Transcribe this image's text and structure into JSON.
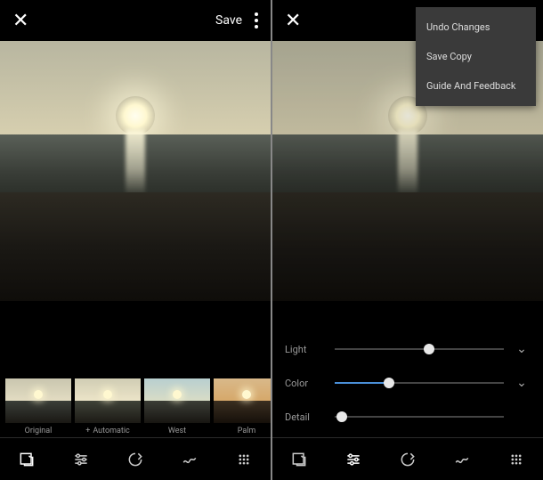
{
  "left": {
    "save_label": "Save",
    "filters": [
      {
        "label": "Original",
        "sky": "linear-gradient(180deg,#c9c6af,#e3dcc2)",
        "bot": "linear-gradient(180deg,#3a3e38,#1a1814)"
      },
      {
        "label": "Automatic",
        "icon": "+",
        "sky": "linear-gradient(180deg,#d0cdb4,#ece4c8)",
        "bot": "linear-gradient(180deg,#3f4238,#1c1a15)"
      },
      {
        "label": "West",
        "sky": "linear-gradient(180deg,#b8cfd0,#d8dcc6)",
        "bot": "linear-gradient(180deg,#3b3d36,#181612)"
      },
      {
        "label": "Palm",
        "sky": "linear-gradient(180deg,#d9b98a,#d6a86a)",
        "bot": "linear-gradient(180deg,#3a2e20,#16100a)"
      }
    ]
  },
  "right": {
    "menu": [
      "Undo Changes",
      "Save Copy",
      "Guide And Feedback"
    ],
    "sliders": [
      {
        "label": "Light",
        "value": 56,
        "fill": false,
        "expandable": true
      },
      {
        "label": "Color",
        "value": 32,
        "fill": true,
        "expandable": true
      },
      {
        "label": "Detail",
        "value": 4,
        "fill": false,
        "expandable": false
      }
    ]
  }
}
